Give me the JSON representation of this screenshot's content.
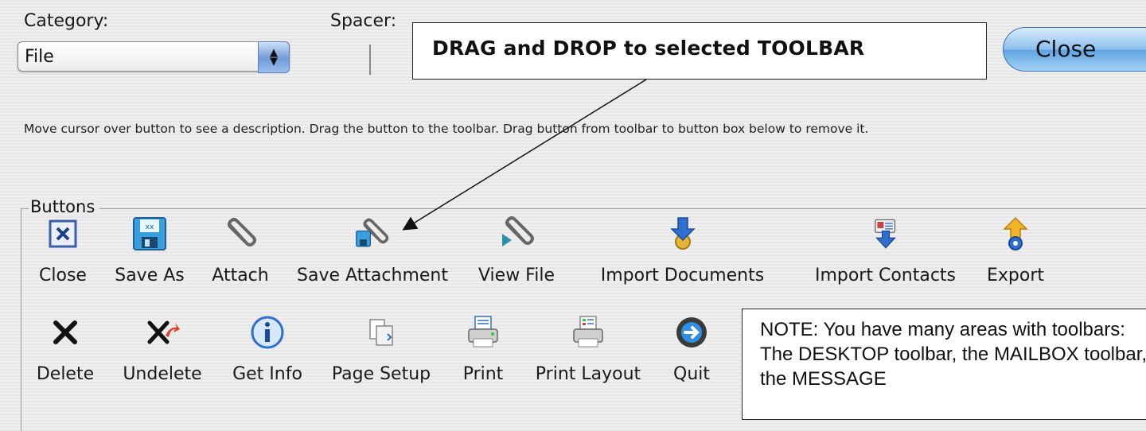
{
  "category": {
    "label": "Category:",
    "selected": "File"
  },
  "spacer": {
    "label": "Spacer:"
  },
  "callout": {
    "text": "DRAG and DROP to selected TOOLBAR"
  },
  "close_button": {
    "label": "Close"
  },
  "instructions": "Move cursor over button to see a description. Drag the button to the toolbar. Drag button from toolbar to button box below to remove it.",
  "buttons_group": {
    "legend": "Buttons",
    "row1": [
      {
        "label": "Close",
        "icon": "close-box-icon"
      },
      {
        "label": "Save As",
        "icon": "floppy-disk-icon"
      },
      {
        "label": "Attach",
        "icon": "paperclip-icon"
      },
      {
        "label": "Save Attachment",
        "icon": "paperclip-floppy-icon"
      },
      {
        "label": "View File",
        "icon": "paperclip-view-icon"
      },
      {
        "label": "Import Documents",
        "icon": "import-documents-icon"
      },
      {
        "label": "Import Contacts",
        "icon": "import-contacts-icon"
      },
      {
        "label": "Export",
        "icon": "export-icon"
      }
    ],
    "row2": [
      {
        "label": "Delete",
        "icon": "delete-x-icon"
      },
      {
        "label": "Undelete",
        "icon": "undelete-icon"
      },
      {
        "label": "Get Info",
        "icon": "info-icon"
      },
      {
        "label": "Page Setup",
        "icon": "page-setup-icon"
      },
      {
        "label": "Print",
        "icon": "printer-icon"
      },
      {
        "label": "Print Layout",
        "icon": "print-layout-icon"
      },
      {
        "label": "Quit",
        "icon": "quit-icon"
      }
    ]
  },
  "note": {
    "text": "NOTE: You have many areas with toolbars: The DESKTOP toolbar, the MAILBOX toolbar, the MESSAGE"
  },
  "colors": {
    "accent_blue": "#2f6fd0",
    "close_red": "#c0392b"
  }
}
